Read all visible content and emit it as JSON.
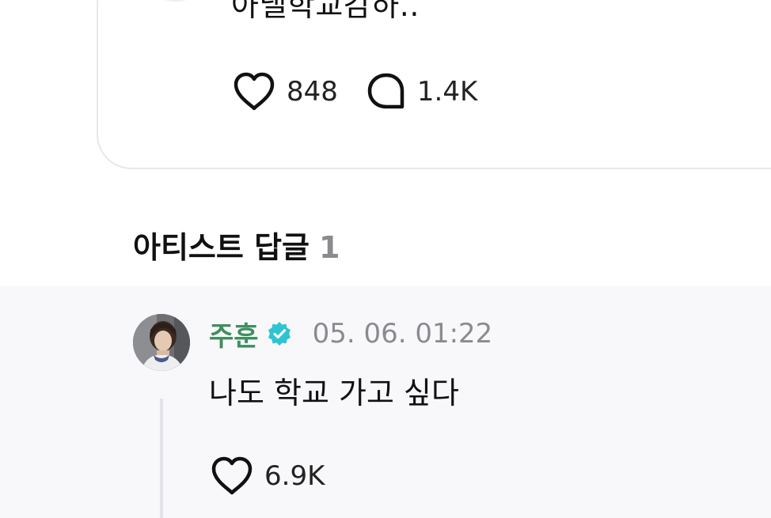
{
  "post": {
    "text": "아낼학교감하..",
    "likes": "848",
    "comments": "1.4K"
  },
  "artist_replies": {
    "title": "아티스트 답글",
    "count": "1"
  },
  "reply": {
    "author": "주훈",
    "timestamp": "05. 06. 01:22",
    "text": "나도 학교 가고 싶다",
    "likes": "6.9K",
    "verified_icon": "verified-badge-icon",
    "verified_color": "#2ec4d3"
  },
  "colors": {
    "author_name": "#3f8e5f",
    "muted": "#8a8a8f",
    "reply_background": "#f8f8fb"
  }
}
